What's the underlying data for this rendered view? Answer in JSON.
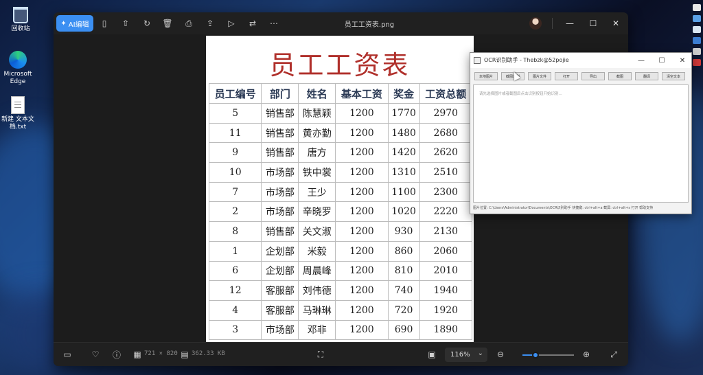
{
  "desktop": {
    "icons": [
      {
        "label": "回收站",
        "icon": "recycle-bin-icon"
      },
      {
        "label": "Microsoft Edge",
        "icon": "edge-icon"
      },
      {
        "label": "新建 文本文档.txt",
        "icon": "text-file-icon"
      }
    ]
  },
  "viewer": {
    "ai_button_label": "AI编辑",
    "file_title": "员工工资表.png",
    "toolbar_icons": [
      "sidebar-icon",
      "upload-icon",
      "rotate-icon",
      "delete-icon",
      "print-icon",
      "share-icon",
      "slideshow-icon",
      "compare-icon",
      "more-icon"
    ],
    "window_controls": {
      "minimize": "—",
      "maximize": "☐",
      "close": "✕"
    },
    "bottom": {
      "dimensions": "721 × 820",
      "file_size": "362.33 KB",
      "zoom_value": "116%",
      "zoom_level": 0.25
    }
  },
  "sheet": {
    "title": "员工工资表",
    "headers": [
      "员工编号",
      "部门",
      "姓名",
      "基本工资",
      "奖金",
      "工资总额"
    ],
    "rows": [
      [
        "5",
        "销售部",
        "陈慧颖",
        "1200",
        "1770",
        "2970"
      ],
      [
        "11",
        "销售部",
        "黄亦勤",
        "1200",
        "1480",
        "2680"
      ],
      [
        "9",
        "销售部",
        "唐方",
        "1200",
        "1420",
        "2620"
      ],
      [
        "10",
        "市场部",
        "铁中裳",
        "1200",
        "1310",
        "2510"
      ],
      [
        "7",
        "市场部",
        "王少",
        "1200",
        "1100",
        "2300"
      ],
      [
        "2",
        "市场部",
        "辛晓罗",
        "1200",
        "1020",
        "2220"
      ],
      [
        "8",
        "销售部",
        "关文淑",
        "1200",
        "930",
        "2130"
      ],
      [
        "1",
        "企划部",
        "米毅",
        "1200",
        "860",
        "2060"
      ],
      [
        "6",
        "企划部",
        "周晨峰",
        "1200",
        "810",
        "2010"
      ],
      [
        "12",
        "客服部",
        "刘伟德",
        "1200",
        "740",
        "1940"
      ],
      [
        "4",
        "客服部",
        "马琳琳",
        "1200",
        "720",
        "1920"
      ],
      [
        "3",
        "市场部",
        "邓非",
        "1200",
        "690",
        "1890"
      ]
    ]
  },
  "ocr": {
    "title": "OCR识别助手 - Thebzk@52pojie",
    "buttons": [
      "本地图片",
      "截图识别",
      "图片文件",
      "打开",
      "导出",
      "截图",
      "翻译",
      "清空文本"
    ],
    "hint": "请先选择图片或者截图后点击识别按钮开始识别...",
    "status": "图片位置: C:\\Users\\Administrator\\Documents\\OCR识别助手  快捷键: ctrl+alt+a  截屏: ctrl+alt+s  打开  帮助支持"
  }
}
